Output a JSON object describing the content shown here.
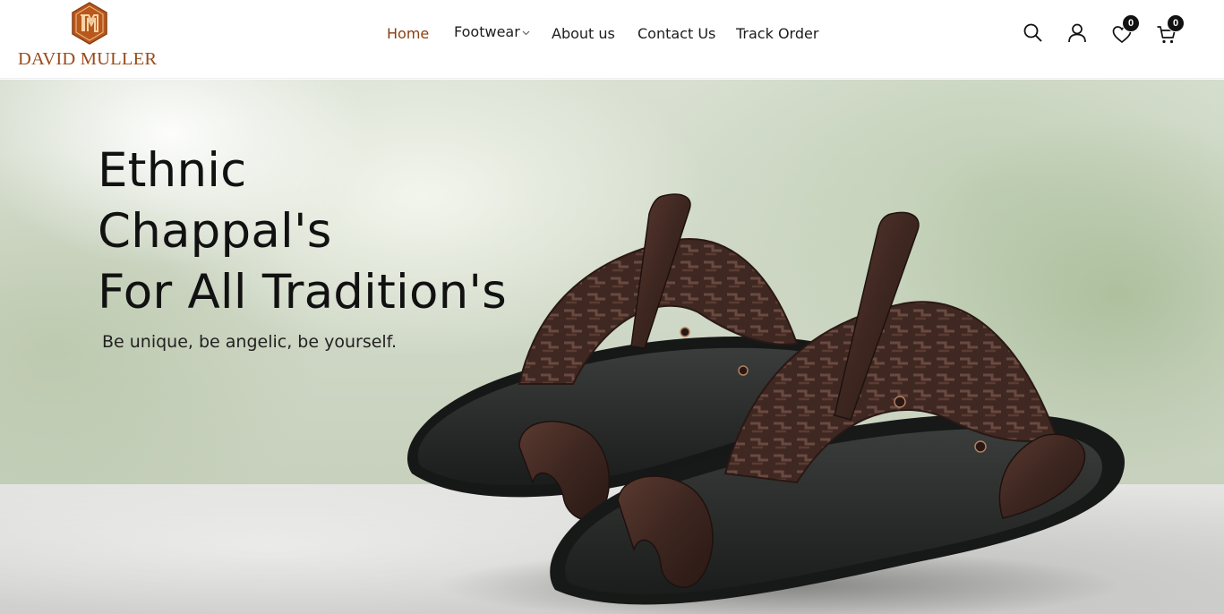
{
  "brand": {
    "name": "DAVID MULLER",
    "accent_color": "#9a4a19"
  },
  "nav": {
    "items": [
      {
        "label": "Home",
        "active": true
      },
      {
        "label": "Footwear",
        "has_dropdown": true
      },
      {
        "label": "About us"
      },
      {
        "label": "Contact Us"
      },
      {
        "label": "Track Order"
      }
    ],
    "active_color": "#8a3f12"
  },
  "header_icons": {
    "search": "search-icon",
    "account": "user-icon",
    "wishlist": "heart-icon",
    "wishlist_count": "0",
    "cart": "cart-icon",
    "cart_count": "0"
  },
  "hero": {
    "title_lines": [
      "Ethnic",
      "Chappal's",
      "For All Tradition's"
    ],
    "subtitle": "Be unique, be angelic, be yourself.",
    "image": "dark-brown-leather-toe-ring-chappal-pair"
  }
}
